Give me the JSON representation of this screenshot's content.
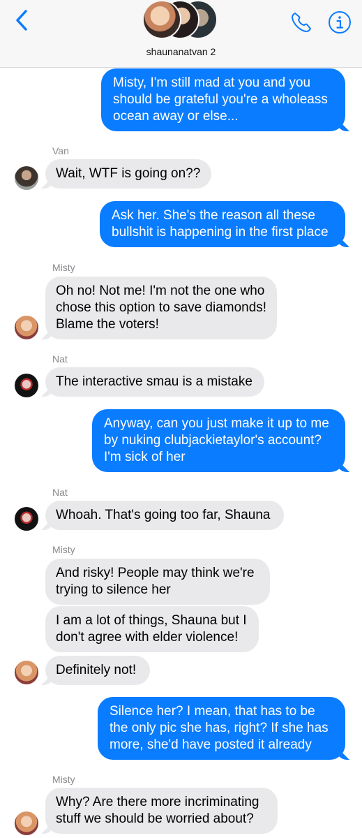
{
  "header": {
    "group_name": "shaunanatvan 2",
    "back_icon": "chevron-left-icon",
    "call_icon": "phone-icon",
    "info_icon": "info-icon",
    "accent_color": "#0a7cff"
  },
  "messages": [
    {
      "direction": "outgoing",
      "text": "Misty, I'm still mad at you and you\nshould be grateful you're a wholeass\nocean away or else..."
    },
    {
      "direction": "incoming",
      "sender": "Van",
      "text": "Wait, WTF is going on??"
    },
    {
      "direction": "outgoing",
      "text": "Ask her. She's the reason all these\nbullshit is happening in the first place"
    },
    {
      "direction": "incoming",
      "sender": "Misty",
      "text": "Oh no! Not me! I'm not the one who\nchose this option to save diamonds!\nBlame the voters!"
    },
    {
      "direction": "incoming",
      "sender": "Nat",
      "text": "The interactive smau is a mistake"
    },
    {
      "direction": "outgoing",
      "text": "Anyway, can you just make it up to me\nby nuking clubjackietaylor's account?\nI'm sick of her"
    },
    {
      "direction": "incoming",
      "sender": "Nat",
      "text": "Whoah. That's going too far, Shauna"
    },
    {
      "direction": "incoming",
      "sender": "Misty",
      "text": "And risky! People may think we're\ntrying to silence her"
    },
    {
      "direction": "incoming",
      "text": "I am a lot of things, Shauna but I\ndon't agree with elder violence!"
    },
    {
      "direction": "incoming",
      "text": "Definitely not!"
    },
    {
      "direction": "outgoing",
      "text": "Silence her? I mean, that has to be\nthe only pic she has, right? If she has\nmore, she'd have posted it already"
    },
    {
      "direction": "incoming",
      "sender": "Misty",
      "text": "Why? Are there more incriminating\nstuff we should be worried about?"
    }
  ]
}
